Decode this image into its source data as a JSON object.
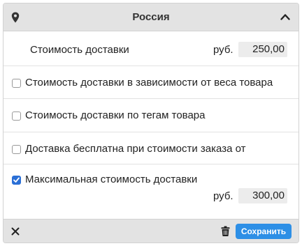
{
  "header": {
    "title": "Россия",
    "pin_icon": "map-pin-icon",
    "collapse_icon": "chevron-up-icon"
  },
  "shipping_cost": {
    "label": "Стоимость доставки",
    "unit": "руб.",
    "value": "250,00"
  },
  "options": [
    {
      "label": "Стоимость доставки в зависимости от веса товара",
      "checked": false
    },
    {
      "label": "Стоимость доставки по тегам товара",
      "checked": false
    },
    {
      "label": "Доставка бесплатна при стоимости заказа от",
      "checked": false
    },
    {
      "label": "Максимальная стоимость доставки",
      "checked": true,
      "unit": "руб.",
      "value": "300,00"
    }
  ],
  "footer": {
    "close_icon": "close-icon",
    "trash_icon": "trash-icon",
    "save_label": "Сохранить"
  },
  "colors": {
    "accent": "#2d8fe6",
    "header_bg": "#e3e3e3",
    "input_bg": "#ececec"
  }
}
